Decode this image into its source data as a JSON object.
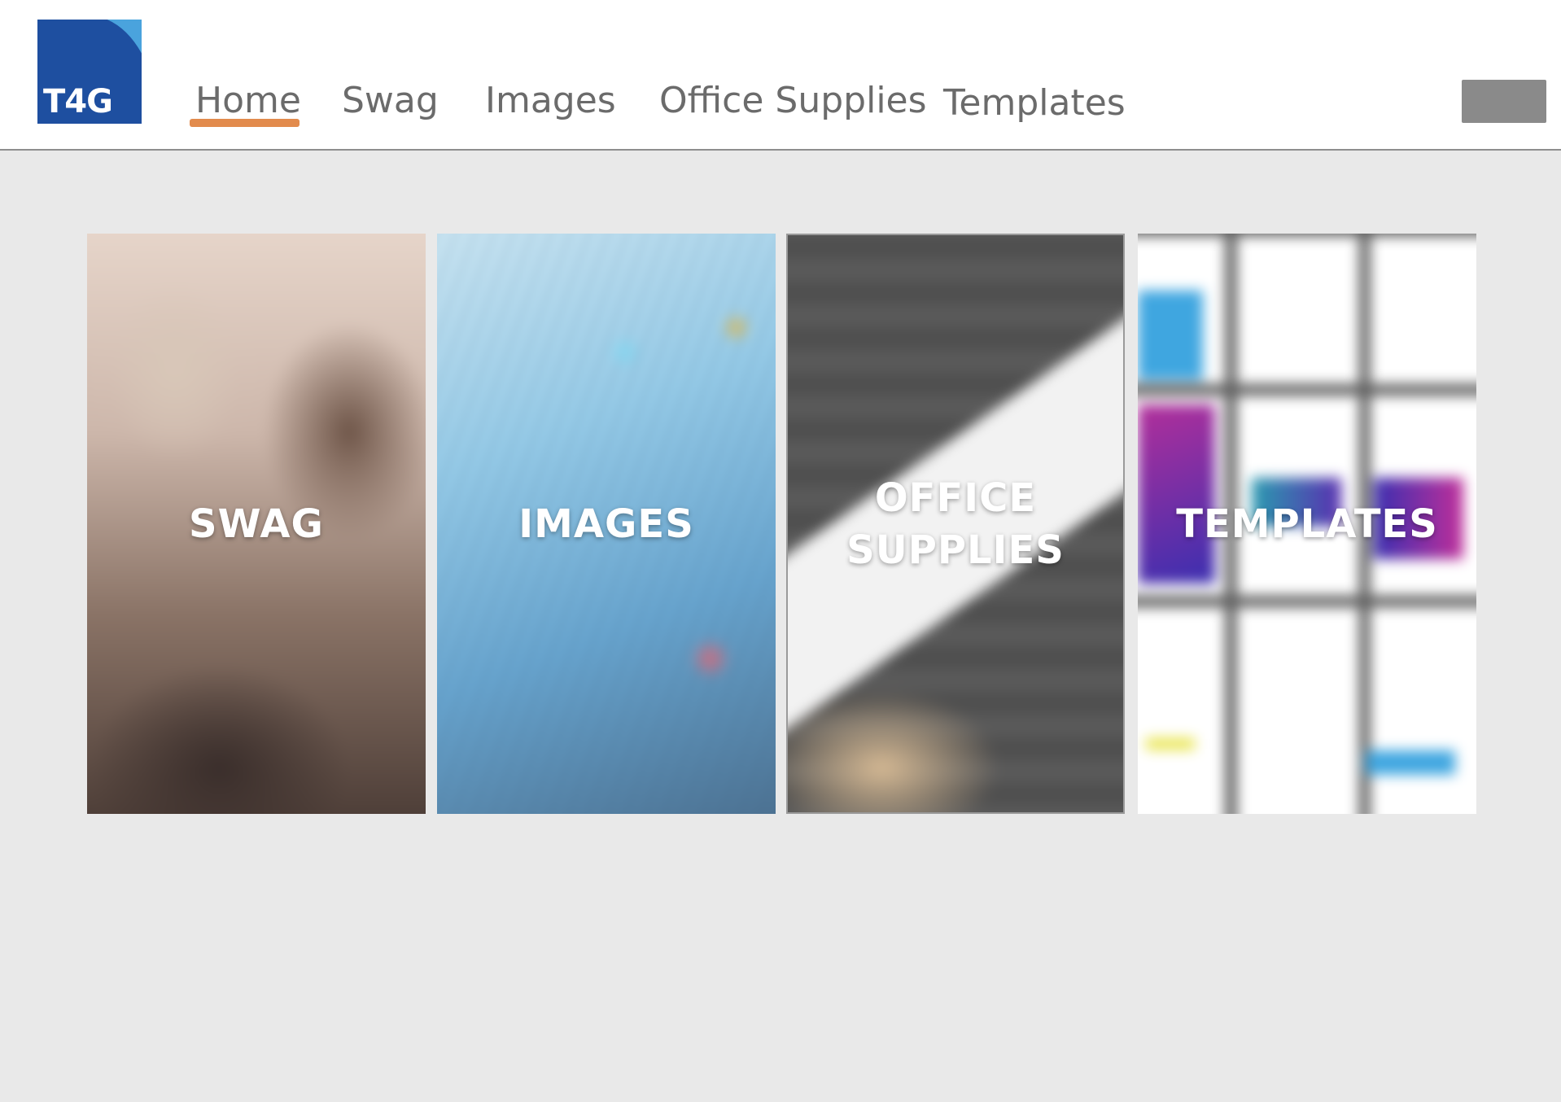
{
  "logo": {
    "text": "T4G",
    "icon": "t4g-logo-icon",
    "brand_color": "#1e4fa0",
    "accent_color": "#4aa3dd"
  },
  "nav": {
    "items": [
      {
        "label": "Home",
        "active": true
      },
      {
        "label": "Swag",
        "active": false
      },
      {
        "label": "Images",
        "active": false
      },
      {
        "label": "Office Supplies",
        "active": false
      },
      {
        "label": "Templates",
        "active": false
      }
    ],
    "active_underline_color": "#e28b4d",
    "menu_button_icon": "menu-button-icon"
  },
  "tiles": [
    {
      "caption": "SWAG"
    },
    {
      "caption": "IMAGES"
    },
    {
      "caption_line1": "OFFICE",
      "caption_line2": "SUPPLIES"
    },
    {
      "caption": "TEMPLATES"
    }
  ]
}
